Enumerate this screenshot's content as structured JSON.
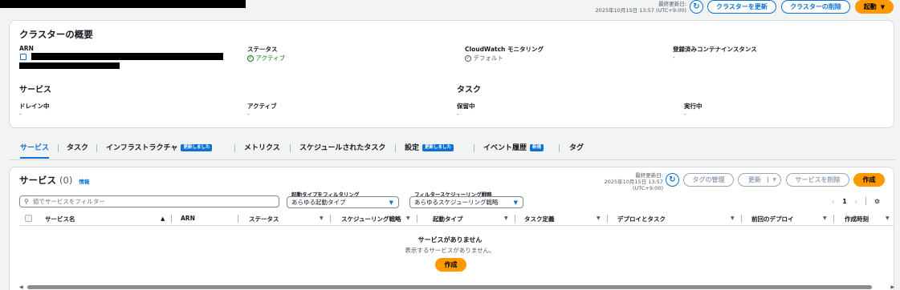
{
  "header": {
    "updated_label": "最終更新日:",
    "updated_time": "2025年10月15日 13:57 (UTC+9:00)",
    "update_cluster_label": "クラスターを更新",
    "delete_cluster_label": "クラスターの削除",
    "launch_label": "起動"
  },
  "overview": {
    "title": "クラスターの概要",
    "arn_label": "ARN",
    "status_label": "ステータス",
    "status_value": "アクティブ",
    "cloudwatch_label": "CloudWatch モニタリング",
    "cloudwatch_value": "デフォルト",
    "registered_label": "登録済みコンテナインスタンス",
    "registered_value": "-",
    "services_title": "サービス",
    "tasks_title": "タスク",
    "draining_label": "ドレイン中",
    "draining_value": "-",
    "active_label": "アクティブ",
    "active_value": "-",
    "pending_label": "保留中",
    "pending_value": "-",
    "running_label": "実行中",
    "running_value": "-"
  },
  "tabs": [
    {
      "label": "サービス"
    },
    {
      "label": "タスク"
    },
    {
      "label": "インフラストラクチャ",
      "badge": "更新しました"
    },
    {
      "label": "メトリクス"
    },
    {
      "label": "スケジュールされたタスク"
    },
    {
      "label": "設定",
      "badge": "更新しました"
    },
    {
      "label": "イベント履歴",
      "badge": "新規"
    },
    {
      "label": "タグ"
    }
  ],
  "services": {
    "title": "サービス",
    "count": "(0)",
    "info": "情報",
    "updated_label": "最終更新日:",
    "updated_time": "2025年10月15日 13:57 (UTC+9:00)",
    "manage_tags_label": "タグの管理",
    "update_label": "更新",
    "delete_label": "サービスを削除",
    "create_label": "作成",
    "search_placeholder": "値でサービスをフィルター",
    "launch_filter_label": "起動タイプをフィルタリング",
    "launch_filter_value": "あらゆる起動タイプ",
    "strategy_filter_label": "フィルタースケジューリング戦略",
    "strategy_filter_value": "あらゆるスケジューリング戦略",
    "page_number": "1",
    "columns": [
      "サービス名",
      "ARN",
      "ステータス",
      "スケジューリング戦略",
      "起動タイプ",
      "タスク定義",
      "デプロイとタスク",
      "前回のデプロイ",
      "作成時刻"
    ],
    "empty_title": "サービスがありません",
    "empty_desc": "表示するサービスがありません。",
    "empty_create_label": "作成"
  },
  "colors": {
    "primary": "#0972d3",
    "accent": "#ff9900",
    "success": "#037f0c"
  }
}
